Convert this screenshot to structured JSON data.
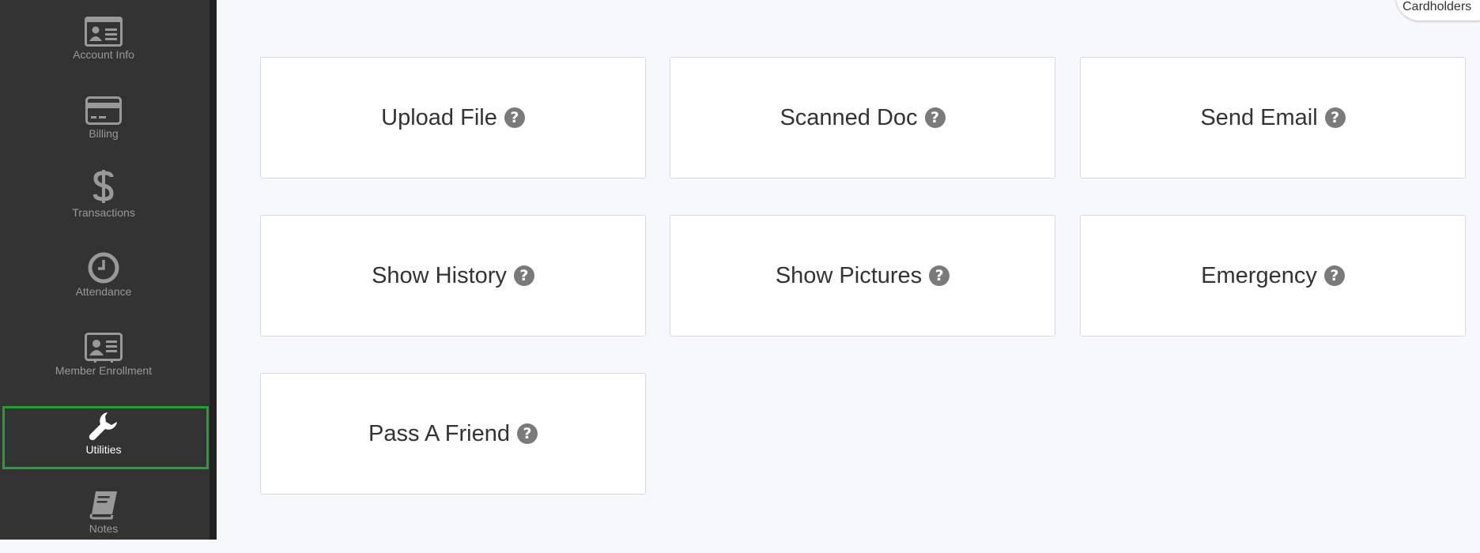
{
  "sidebar": {
    "items": [
      {
        "label": "Account Info",
        "icon": "id-card-icon"
      },
      {
        "label": "Billing",
        "icon": "credit-card-icon"
      },
      {
        "label": "Transactions",
        "icon": "dollar-icon"
      },
      {
        "label": "Attendance",
        "icon": "clock-icon"
      },
      {
        "label": "Member Enrollment",
        "icon": "id-badge-icon"
      },
      {
        "label": "Utilities",
        "icon": "wrench-icon",
        "active": true
      },
      {
        "label": "Notes",
        "icon": "book-icon"
      }
    ]
  },
  "header": {
    "cardholders_label": "Cardholders"
  },
  "tiles": [
    {
      "label": "Upload File"
    },
    {
      "label": "Scanned Doc"
    },
    {
      "label": "Send Email"
    },
    {
      "label": "Show History"
    },
    {
      "label": "Show Pictures"
    },
    {
      "label": "Emergency"
    },
    {
      "label": "Pass A Friend"
    }
  ],
  "help_glyph": "?",
  "colors": {
    "sidebar_bg": "#333333",
    "active_border": "#21a034",
    "page_bg": "#f7f8fc",
    "help_icon": "#7a7a7a"
  }
}
